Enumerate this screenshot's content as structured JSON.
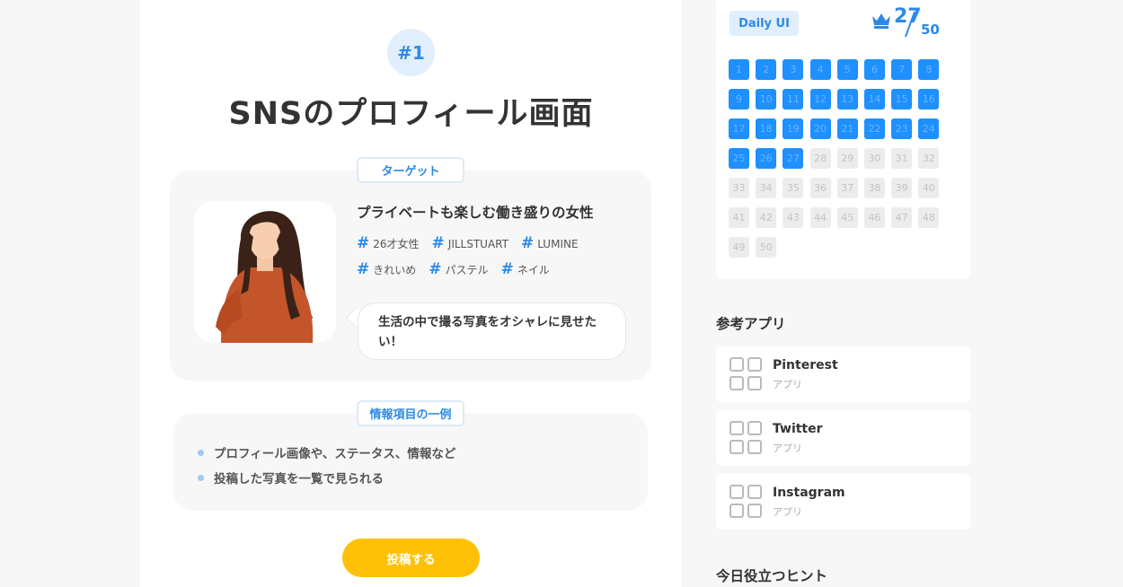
{
  "challenge": {
    "number_label": "#1",
    "title": "SNSのプロフィール画面"
  },
  "target": {
    "tag": "ターゲット",
    "heading": "プライベートも楽しむ働き盛りの女性",
    "hashtags_row1": [
      "26才女性",
      "JILLSTUART",
      "LUMINE"
    ],
    "hashtags_row2": [
      "きれいめ",
      "パステル",
      "ネイル"
    ],
    "quote": "生活の中で撮る写真をオシャレに見せたい！"
  },
  "info": {
    "tag": "情報項目の一例",
    "items": [
      "プロフィール画像や、ステータス、情報など",
      "投稿した写真を一覧で見られる"
    ]
  },
  "post_button": "投稿する",
  "sidebar": {
    "daily_tag": "Daily UI",
    "progress_done": "27",
    "progress_total": "50",
    "days": [
      "1",
      "2",
      "3",
      "4",
      "5",
      "6",
      "7",
      "8",
      "9",
      "10",
      "11",
      "12",
      "13",
      "14",
      "15",
      "16",
      "17",
      "18",
      "19",
      "20",
      "21",
      "22",
      "23",
      "24",
      "25",
      "26",
      "27",
      "28",
      "29",
      "30",
      "31",
      "32",
      "33",
      "34",
      "35",
      "36",
      "37",
      "38",
      "39",
      "40",
      "41",
      "42",
      "43",
      "44",
      "45",
      "46",
      "47",
      "48",
      "49",
      "50"
    ],
    "completed_days": 27,
    "apps_heading": "参考アプリ",
    "apps": [
      {
        "name": "Pinterest",
        "type": "アプリ"
      },
      {
        "name": "Twitter",
        "type": "アプリ"
      },
      {
        "name": "Instagram",
        "type": "アプリ"
      }
    ],
    "tips_heading": "今日役立つヒント"
  },
  "colors": {
    "accent": "#2d8ae6",
    "day_done": "#1e90ff",
    "button": "#ffc107"
  }
}
